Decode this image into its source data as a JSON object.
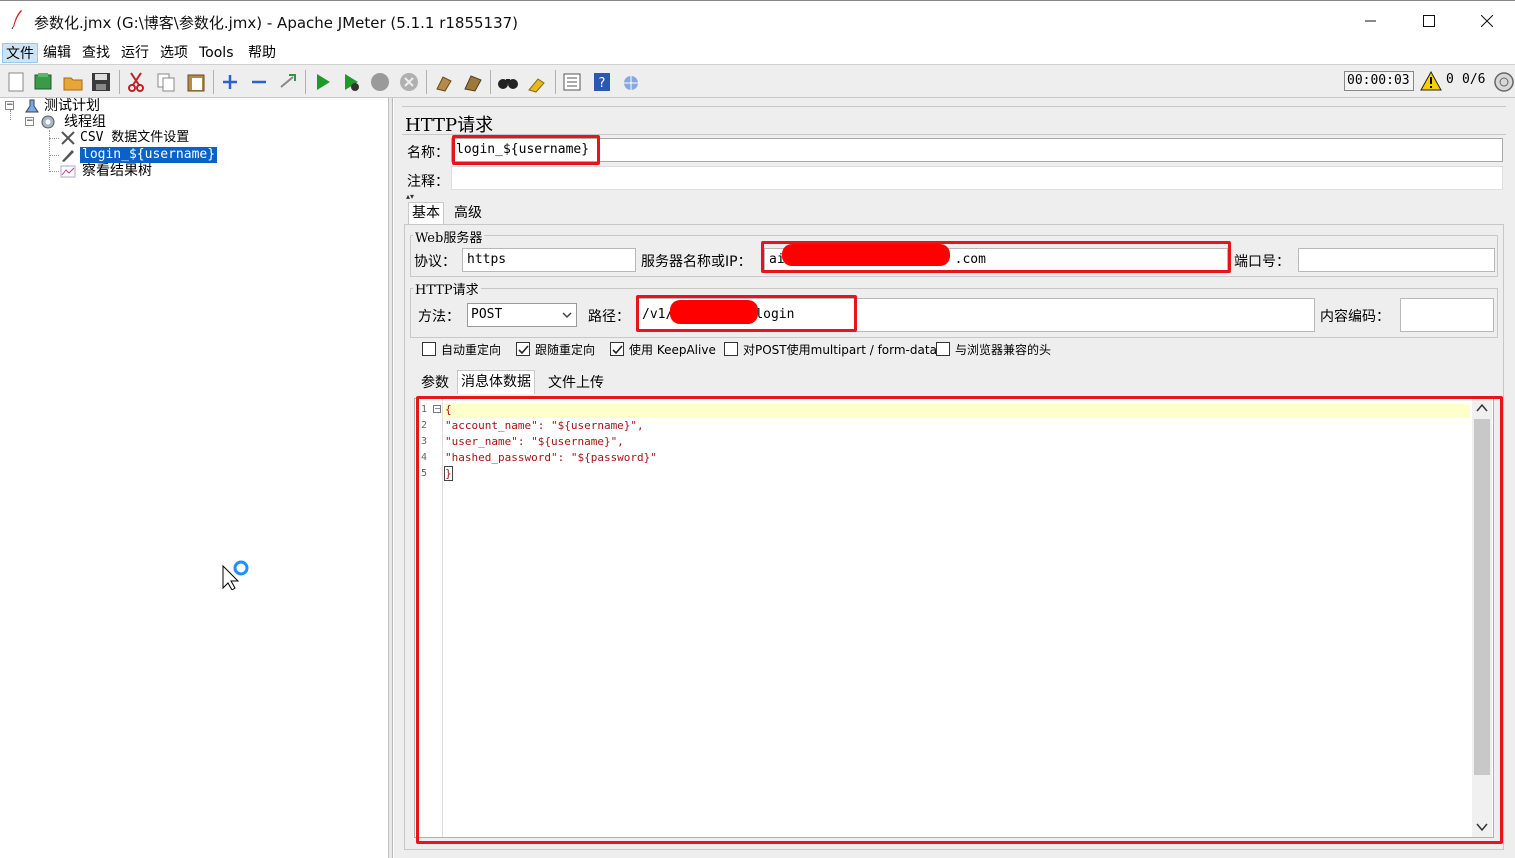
{
  "window": {
    "title": "参数化.jmx (G:\\博客\\参数化.jmx) - Apache JMeter (5.1.1 r1855137)",
    "minimize": "—",
    "maximize": "☐",
    "close": "✕"
  },
  "menu": [
    "文件",
    "编辑",
    "查找",
    "运行",
    "选项",
    "Tools",
    "帮助"
  ],
  "toolbar": {
    "timer": "00:00:03",
    "warnings": "0",
    "threads": "0/6"
  },
  "tree": {
    "root": "测试计划",
    "thread_group": "线程组",
    "csv": "CSV 数据文件设置",
    "sampler": "login_${username}",
    "listener": "察看结果树"
  },
  "panel": {
    "title": "HTTP请求",
    "name_label": "名称：",
    "name_value": "login_${username}",
    "comment_label": "注释：",
    "comment_value": "",
    "tabs": [
      "基本",
      "高级"
    ],
    "web_server": {
      "title": "Web服务器",
      "protocol_label": "协议：",
      "protocol_value": "https",
      "server_label": "服务器名称或IP：",
      "server_prefix": "ai",
      "server_suffix": ".com",
      "port_label": "端口号：",
      "port_value": ""
    },
    "http_request": {
      "title": "HTTP请求",
      "method_label": "方法：",
      "method_value": "POST",
      "path_label": "路径：",
      "path_prefix": "/v1/",
      "path_suffix": "login",
      "encoding_label": "内容编码：",
      "encoding_value": ""
    },
    "checkboxes": [
      {
        "label": "自动重定向",
        "checked": false
      },
      {
        "label": "跟随重定向",
        "checked": true
      },
      {
        "label": "使用 KeepAlive",
        "checked": true
      },
      {
        "label": "对POST使用multipart / form-data",
        "checked": false
      },
      {
        "label": "与浏览器兼容的头",
        "checked": false
      }
    ],
    "body_tabs": [
      "参数",
      "消息体数据",
      "文件上传"
    ],
    "body_lines": [
      {
        "num": "1",
        "text": "{"
      },
      {
        "num": "2",
        "text": "\"account_name\": \"${username}\","
      },
      {
        "num": "3",
        "text": "\"user_name\": \"${username}\","
      },
      {
        "num": "4",
        "text": "\"hashed_password\": \"${password}\""
      },
      {
        "num": "5",
        "text": "}"
      }
    ]
  },
  "colors": {
    "highlight_box": "#e8141c",
    "redaction": "#ff0000",
    "selection": "#0a62c9"
  }
}
